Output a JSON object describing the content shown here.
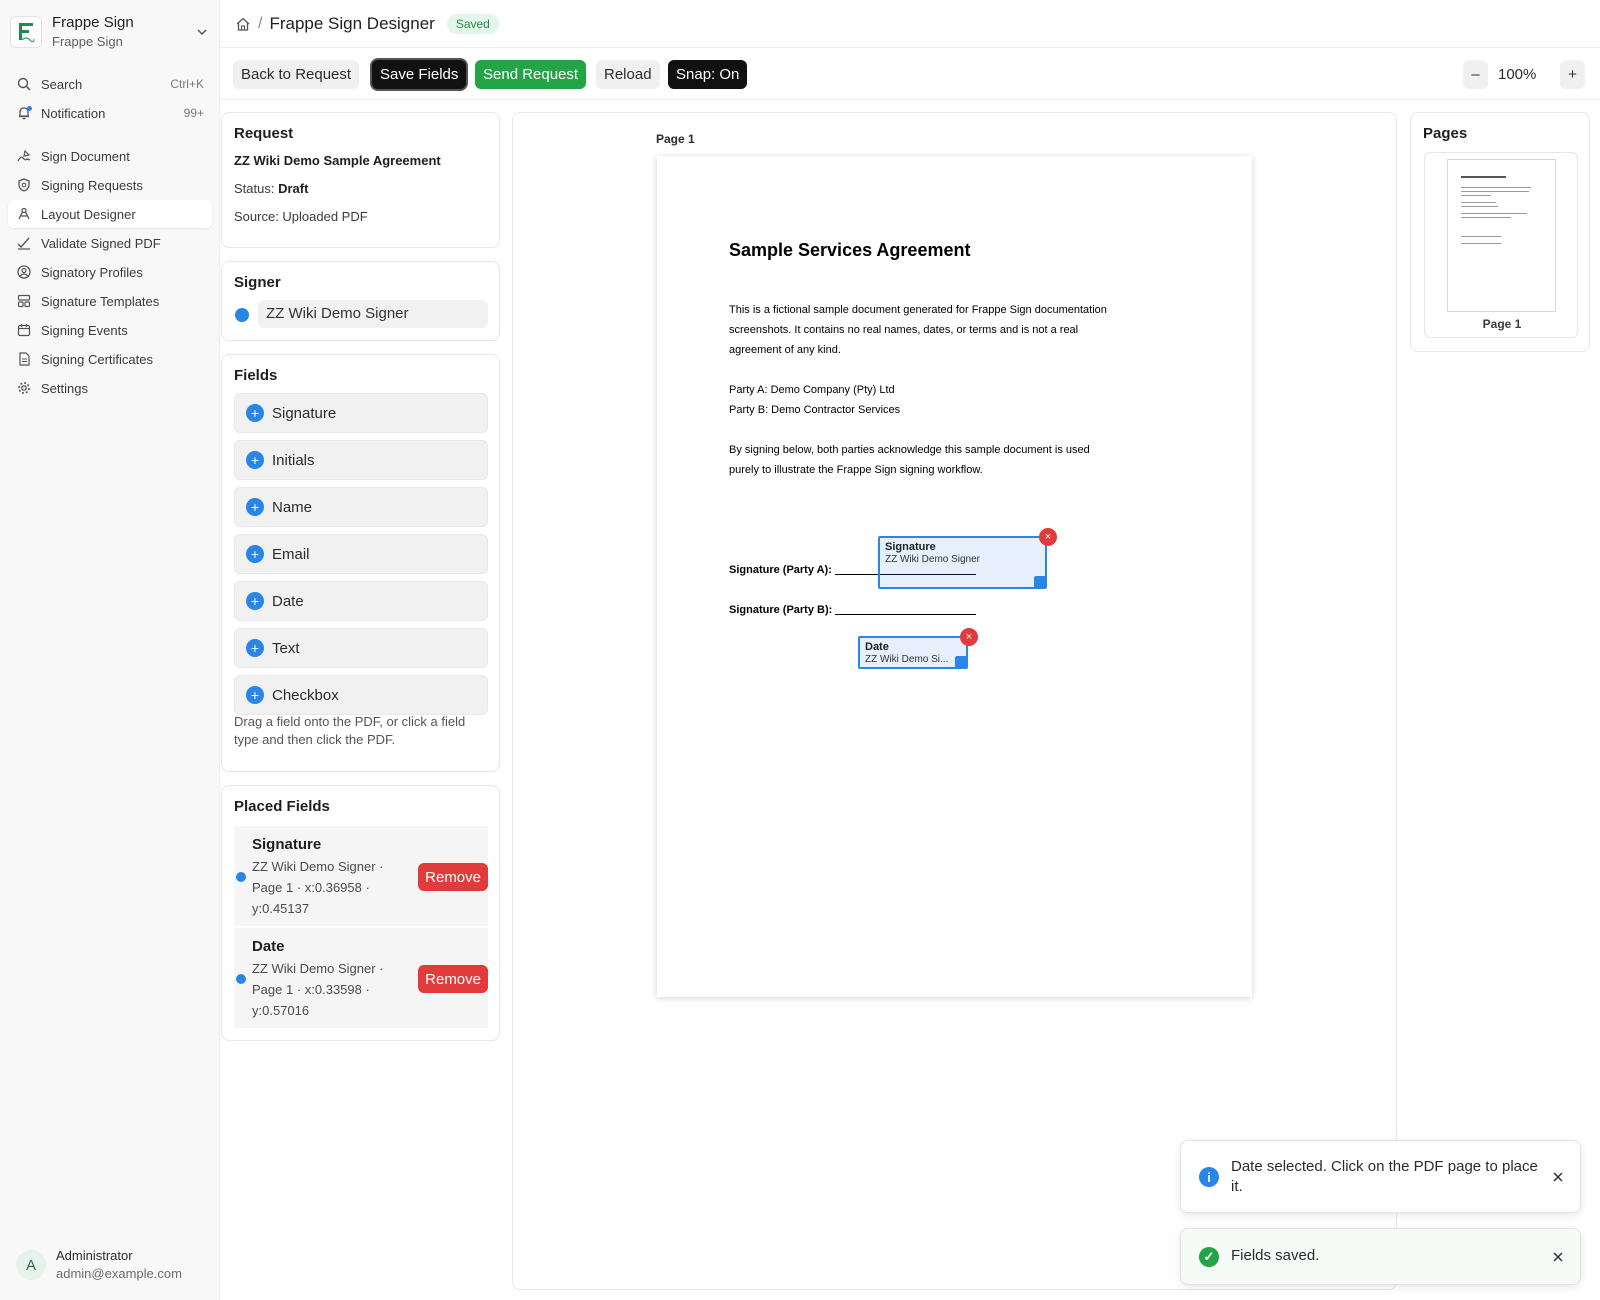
{
  "brand": {
    "title": "Frappe Sign",
    "subtitle": "Frappe Sign"
  },
  "nav": {
    "search": {
      "label": "Search",
      "shortcut": "Ctrl+K"
    },
    "notification": {
      "label": "Notification",
      "count": "99+"
    },
    "items": [
      {
        "label": "Sign Document",
        "icon": "pen-signature-icon"
      },
      {
        "label": "Signing Requests",
        "icon": "shield-icon"
      },
      {
        "label": "Layout Designer",
        "icon": "pen-tool-icon",
        "active": true
      },
      {
        "label": "Validate Signed PDF",
        "icon": "check-signature-icon"
      },
      {
        "label": "Signatory Profiles",
        "icon": "user-circle-icon"
      },
      {
        "label": "Signature Templates",
        "icon": "template-icon"
      },
      {
        "label": "Signing Events",
        "icon": "calendar-icon"
      },
      {
        "label": "Signing Certificates",
        "icon": "document-icon"
      },
      {
        "label": "Settings",
        "icon": "gear-icon"
      }
    ]
  },
  "user": {
    "initial": "A",
    "name": "Administrator",
    "email": "admin@example.com"
  },
  "header": {
    "separator": "/",
    "title": "Frappe Sign Designer",
    "badge": "Saved"
  },
  "toolbar": {
    "back": "Back to Request",
    "save": "Save Fields",
    "send": "Send Request",
    "reload": "Reload",
    "snap": "Snap: On",
    "zoom_out": "–",
    "zoom": "100%",
    "zoom_in": "+"
  },
  "request": {
    "heading": "Request",
    "title": "ZZ Wiki Demo Sample Agreement",
    "status_label": "Status:",
    "status": "Draft",
    "source": "Source: Uploaded PDF"
  },
  "signer": {
    "heading": "Signer",
    "name": "ZZ Wiki Demo Signer",
    "color": "#2a86e6"
  },
  "fields": {
    "heading": "Fields",
    "types": [
      "Signature",
      "Initials",
      "Name",
      "Email",
      "Date",
      "Text",
      "Checkbox"
    ],
    "plus": "+",
    "hint": "Drag a field onto the PDF, or click a field type and then click the PDF."
  },
  "placed": {
    "heading": "Placed Fields",
    "remove_label": "Remove",
    "items": [
      {
        "type": "Signature",
        "signer": "ZZ Wiki Demo Signer ·",
        "page": "Page 1 · x:0.36958 ·",
        "y": "y:0.45137"
      },
      {
        "type": "Date",
        "signer": "ZZ Wiki Demo Signer ·",
        "page": "Page 1 · x:0.33598 ·",
        "y": "y:0.57016"
      }
    ]
  },
  "canvas": {
    "page_label": "Page 1",
    "doc": {
      "title": "Sample Services Agreement",
      "para1_l1": "This is a fictional sample document generated for Frappe Sign documentation",
      "para1_l2": "screenshots. It contains no real names, dates, or terms and is not a real",
      "para1_l3": "agreement of any kind.",
      "party_a": "Party A: Demo Company (Pty) Ltd",
      "party_b": "Party B: Demo Contractor Services",
      "para2_l1": "By signing below, both parties acknowledge this sample document is used",
      "para2_l2": "purely to illustrate the Frappe Sign signing workflow.",
      "sig_a": "Signature (Party A):",
      "sig_b": "Signature (Party B):"
    },
    "boxes": {
      "signature": {
        "type": "Signature",
        "signer": "ZZ Wiki Demo Signer"
      },
      "date": {
        "type": "Date",
        "signer": "ZZ Wiki Demo Si..."
      },
      "close": "×"
    }
  },
  "pages": {
    "heading": "Pages",
    "thumb_label": "Page 1"
  },
  "toasts": [
    {
      "kind": "info",
      "icon": "i",
      "message": "Date selected. Click on the PDF page to place it.",
      "color": "#2a86e6"
    },
    {
      "kind": "success",
      "icon": "✓",
      "message": "Fields saved.",
      "color": "#22a447"
    }
  ],
  "colors": {
    "accent": "#2a86e6",
    "success": "#22a447",
    "danger": "#e23b3b"
  }
}
